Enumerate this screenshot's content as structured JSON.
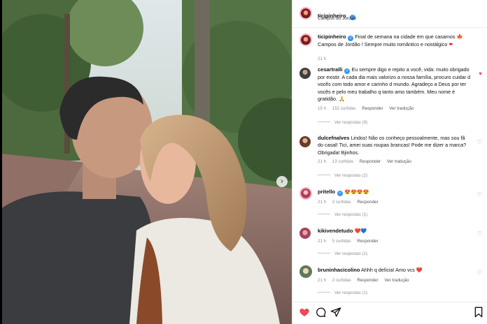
{
  "post": {
    "author": "ticipinheiro",
    "location": "Campos do Jordão",
    "caption_user": "ticipinheiro",
    "caption_text": "Final de semana na cidade em que casamos 🍁 Campos de Jordão ! Sempre muito romântico e nostálgico",
    "caption_time": "21 h"
  },
  "comments": [
    {
      "user": "cesartralli",
      "verified": true,
      "text": "Eu sempre digo e repito a você, vida: muito obrigado por existir. A cada dia mais valorizo a nossa família, procuro cuidar d vocês com todo amor e carinho d mundo. Agradeço a Deus por ter vocês e pelo meu trabalho q tanto amo também. Meu nome é gratidão. 🙏",
      "time": "15 h",
      "likes": "152 curtidas",
      "reply": "Responder",
      "translate": "Ver tradução",
      "replies": "Ver respostas (9)",
      "liked": true
    },
    {
      "user": "dulcefnalves",
      "verified": false,
      "text": "Lindos! Não os conheço pessoalmente, mas sou fã do casal! Tici, amei suas roupas brancas! Pode me dizer a marca? Obrigada! Bjinhos.",
      "time": "21 h",
      "likes": "13 curtidas",
      "reply": "Responder",
      "translate": "Ver tradução",
      "replies": "Ver respostas (2)",
      "liked": false
    },
    {
      "user": "pritello",
      "verified": true,
      "text": "😍😍😍😍",
      "time": "21 h",
      "likes": "2 curtidas",
      "reply": "Responder",
      "translate": "",
      "replies": "Ver respostas (1)",
      "liked": false
    },
    {
      "user": "kikivendetudo",
      "verified": false,
      "text": "❤️💙",
      "time": "21 h",
      "likes": "5 curtidas",
      "reply": "Responder",
      "translate": "",
      "replies": "Ver respostas (1)",
      "liked": false
    },
    {
      "user": "bruninhacicolino",
      "verified": false,
      "text": "Ahhh q delícia! Amo vcs ❤️",
      "time": "21 h",
      "likes": "2 curtidas",
      "reply": "Responder",
      "translate": "Ver tradução",
      "replies": "Ver respostas (1)",
      "liked": false
    }
  ],
  "icons": {
    "like": "heart-icon",
    "comment": "comment-icon",
    "share": "send-icon",
    "save": "bookmark-icon",
    "carousel": "chevron-right-icon"
  },
  "colors": {
    "like_red": "#ed4956",
    "verified_blue": "#3897f0",
    "meta_gray": "#8e8e8e"
  }
}
